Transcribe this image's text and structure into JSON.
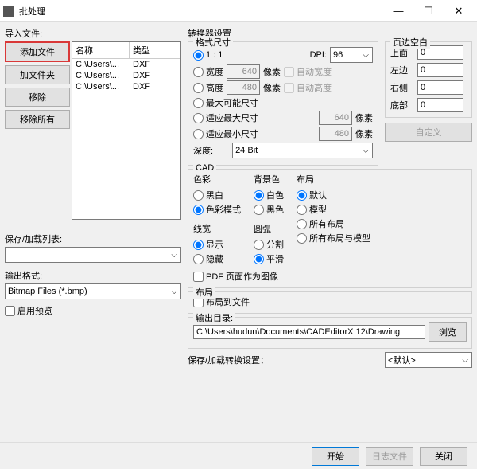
{
  "window": {
    "title": "批处理"
  },
  "left": {
    "import_label": "导入文件:",
    "add_file": "添加文件",
    "add_folder": "加文件夹",
    "remove": "移除",
    "remove_all": "移除所有",
    "cols": {
      "name": "名称",
      "type": "类型"
    },
    "files": [
      {
        "name": "C:\\Users\\...",
        "type": "DXF"
      },
      {
        "name": "C:\\Users\\...",
        "type": "DXF"
      },
      {
        "name": "C:\\Users\\...",
        "type": "DXF"
      }
    ],
    "save_list_label": "保存/加载列表:",
    "output_fmt_label": "输出格式:",
    "output_fmt": "Bitmap Files (*.bmp)",
    "preview": "启用预览"
  },
  "conv": {
    "title": "转换器设置",
    "fmt_title": "格式尺寸",
    "one_to_one": "1 : 1",
    "dpi_label": "DPI:",
    "dpi": "96",
    "width": "宽度",
    "width_v": "640",
    "px": "像素",
    "auto_w": "自动宽度",
    "height": "高度",
    "height_v": "480",
    "auto_h": "自动高度",
    "max_possible": "最大可能尺寸",
    "fit_max": "适应最大尺寸",
    "fit_max_v": "640",
    "fit_min": "适应最小尺寸",
    "fit_min_v": "480",
    "depth": "深度:",
    "depth_v": "24 Bit",
    "margin_title": "页边空白",
    "top": "上面",
    "left_m": "左边",
    "right_m": "右侧",
    "bottom": "底部",
    "margin_v": "0",
    "custom": "自定义",
    "cad_title": "CAD",
    "color": "色彩",
    "bw": "黑白",
    "color_mode": "色彩模式",
    "bg": "背景色",
    "white": "白色",
    "black": "黑色",
    "lw": "线宽",
    "show": "显示",
    "hide": "隐藏",
    "arc": "圆弧",
    "split": "分割",
    "smooth": "平滑",
    "layout": "布局",
    "def": "默认",
    "model": "模型",
    "all_layouts": "所有布局",
    "all_and_model": "所有布局与模型",
    "pdf_as_img": "PDF 页面作为图像",
    "layout2": "布局",
    "layout_to_file": "布局到文件",
    "out_dir_label": "输出目录:",
    "out_dir": "C:\\Users\\hudun\\Documents\\CADEditorX 12\\Drawing",
    "browse": "浏览",
    "save_conv": "保存/加载转换设置：",
    "save_conv_v": "<默认>"
  },
  "footer": {
    "start": "开始",
    "log": "日志文件",
    "close": "关闭"
  }
}
